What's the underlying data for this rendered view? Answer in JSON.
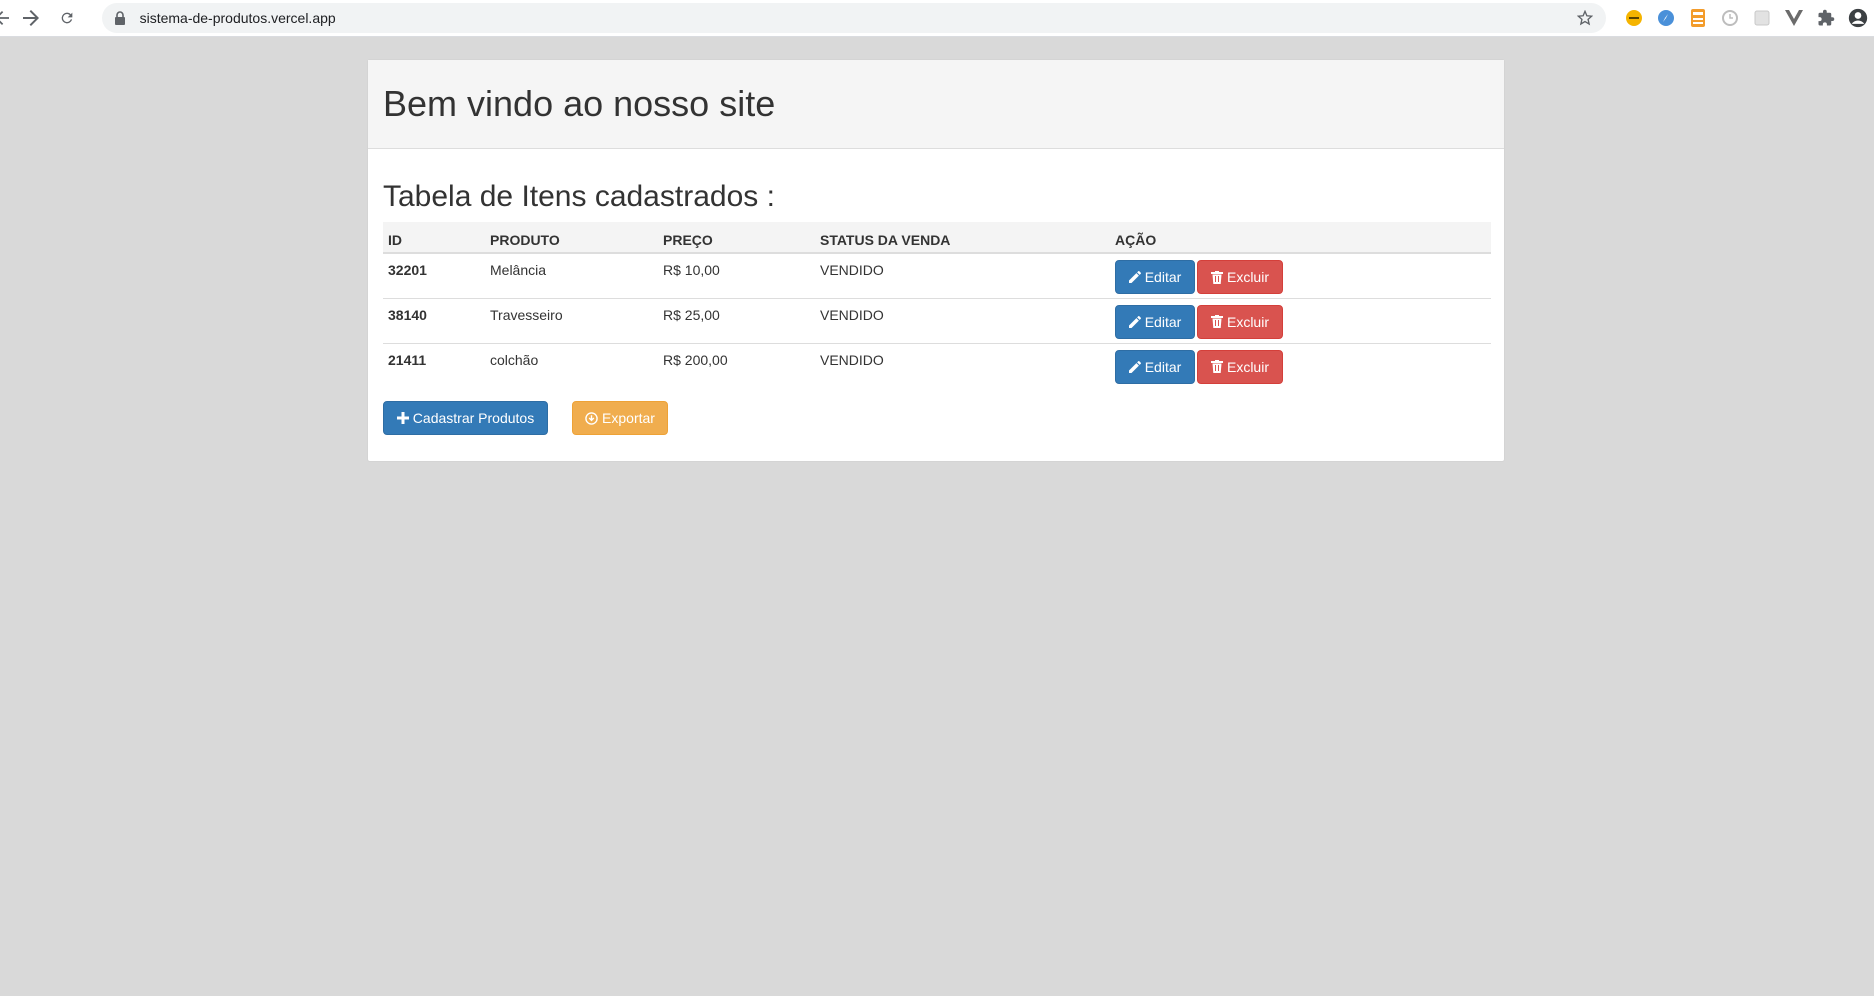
{
  "browser": {
    "url": "sistema-de-produtos.vercel.app",
    "extension_colors": [
      "#f5b400",
      "#4a90d9",
      "#f39c2b",
      "#c8c8c8",
      "#d0d0d0",
      "#6b6b6b",
      "#5f6368",
      "#3c4043"
    ]
  },
  "page": {
    "title": "Bem vindo ao nosso site",
    "section_title": "Tabela de Itens cadastrados :"
  },
  "table": {
    "headers": {
      "id": "ID",
      "produto": "PRODUTO",
      "preco": "PREÇO",
      "status": "STATUS DA VENDA",
      "acao": "AÇÃO"
    },
    "rows": [
      {
        "id": "32201",
        "produto": "Melância",
        "preco": "R$ 10,00",
        "status": "VENDIDO"
      },
      {
        "id": "38140",
        "produto": "Travesseiro",
        "preco": "R$ 25,00",
        "status": "VENDIDO"
      },
      {
        "id": "21411",
        "produto": "colchão",
        "preco": "R$ 200,00",
        "status": "VENDIDO"
      }
    ],
    "edit_label": "Editar",
    "delete_label": "Excluir"
  },
  "actions": {
    "register_label": "Cadastrar Produtos",
    "export_label": "Exportar"
  },
  "colors": {
    "primary": "#337ab7",
    "danger": "#d9534f",
    "warning": "#f0ad4e",
    "background": "#d9d9d9"
  }
}
